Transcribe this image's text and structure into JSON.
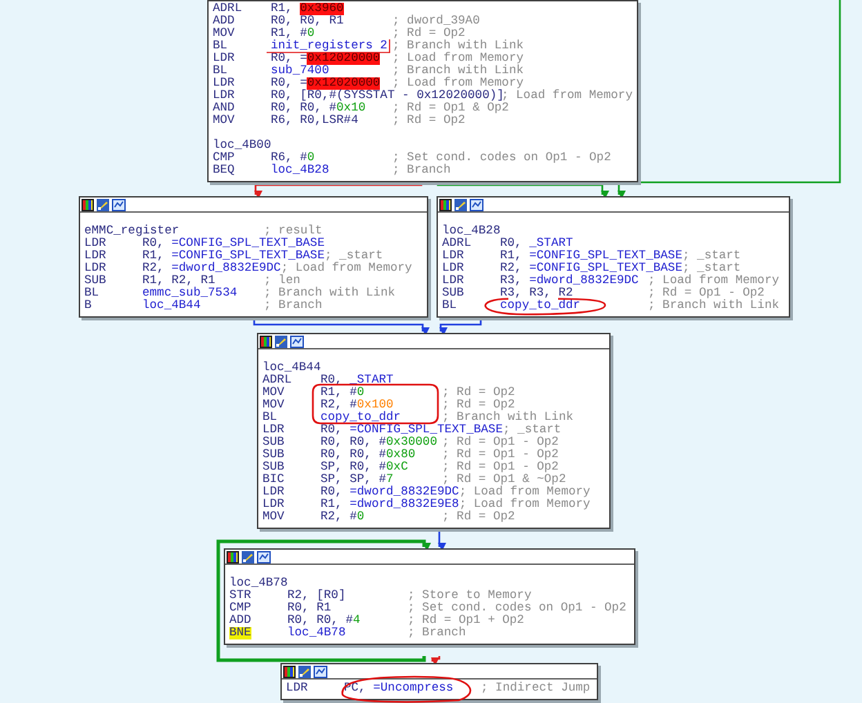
{
  "blocks": [
    {
      "toolbar": false,
      "lines": [
        {
          "kind": "ins",
          "mnemonic": "ADRL",
          "highlighted": false,
          "operands": [
            {
              "text": "R1, ",
              "kind": "reg"
            },
            {
              "text": "0x3960",
              "kind": "mark"
            }
          ]
        },
        {
          "kind": "ins",
          "mnemonic": "ADD",
          "highlighted": false,
          "operands": [
            {
              "text": "R0, R0, R1",
              "kind": "reg"
            }
          ],
          "comment": "; dword_39A0"
        },
        {
          "kind": "ins",
          "mnemonic": "MOV",
          "highlighted": false,
          "operands": [
            {
              "text": "R1, #",
              "kind": "reg"
            },
            {
              "text": "0",
              "kind": "num"
            }
          ],
          "comment": "; Rd = Op2"
        },
        {
          "kind": "ins",
          "mnemonic": "BL",
          "highlighted": false,
          "operands": [
            {
              "text": "init_registers 2",
              "kind": "name"
            }
          ],
          "comment": "; Branch with Link"
        },
        {
          "kind": "ins",
          "mnemonic": "LDR",
          "highlighted": false,
          "operands": [
            {
              "text": "R0, =",
              "kind": "reg"
            },
            {
              "text": "0x12020000",
              "kind": "mark"
            }
          ],
          "comment": "; Load from Memory"
        },
        {
          "kind": "ins",
          "mnemonic": "BL",
          "highlighted": false,
          "operands": [
            {
              "text": "sub_7400",
              "kind": "name"
            }
          ],
          "comment": "; Branch with Link"
        },
        {
          "kind": "ins",
          "mnemonic": "LDR",
          "highlighted": false,
          "operands": [
            {
              "text": "R0, =",
              "kind": "reg"
            },
            {
              "text": "0x12020000",
              "kind": "mark"
            }
          ],
          "comment": "; Load from Memory"
        },
        {
          "kind": "ins",
          "mnemonic": "LDR",
          "highlighted": false,
          "operands": [
            {
              "text": "R0, [R0,#(SYSSTAT - 0x12020000)]",
              "kind": "reg"
            }
          ],
          "comment": "; Load from Memory"
        },
        {
          "kind": "ins",
          "mnemonic": "AND",
          "highlighted": false,
          "operands": [
            {
              "text": "R0, R0, #",
              "kind": "reg"
            },
            {
              "text": "0x10",
              "kind": "num"
            }
          ],
          "comment": "; Rd = Op1 & Op2"
        },
        {
          "kind": "ins",
          "mnemonic": "MOV",
          "highlighted": false,
          "operands": [
            {
              "text": "R6, R0,LSR#4",
              "kind": "reg"
            }
          ],
          "comment": "; Rd = Op2"
        },
        {
          "kind": "blank"
        },
        {
          "kind": "label",
          "text": "loc_4B00"
        },
        {
          "kind": "ins",
          "mnemonic": "CMP",
          "highlighted": false,
          "operands": [
            {
              "text": "R6, #",
              "kind": "reg"
            },
            {
              "text": "0",
              "kind": "num"
            }
          ],
          "comment": "; Set cond. codes on Op1 - Op2"
        },
        {
          "kind": "ins",
          "mnemonic": "BEQ",
          "highlighted": false,
          "operands": [
            {
              "text": "loc_4B28",
              "kind": "name"
            }
          ],
          "comment": "; Branch"
        }
      ]
    },
    {
      "toolbar": true,
      "lines": [
        {
          "kind": "label",
          "text": "eMMC_register",
          "comment": "; result"
        },
        {
          "kind": "ins",
          "mnemonic": "LDR",
          "highlighted": false,
          "operands": [
            {
              "text": "R0, ",
              "kind": "reg"
            },
            {
              "text": "=CONFIG_SPL_TEXT_BASE",
              "kind": "name"
            }
          ]
        },
        {
          "kind": "ins",
          "mnemonic": "LDR",
          "highlighted": false,
          "operands": [
            {
              "text": "R1, ",
              "kind": "reg"
            },
            {
              "text": "=CONFIG_SPL_TEXT_BASE",
              "kind": "name"
            }
          ],
          "comment": "; _start"
        },
        {
          "kind": "ins",
          "mnemonic": "LDR",
          "highlighted": false,
          "operands": [
            {
              "text": "R2, ",
              "kind": "reg"
            },
            {
              "text": "=dword_8832E9DC",
              "kind": "name"
            }
          ],
          "comment": "; Load from Memory"
        },
        {
          "kind": "ins",
          "mnemonic": "SUB",
          "highlighted": false,
          "operands": [
            {
              "text": "R1, R2, R1",
              "kind": "reg"
            }
          ],
          "comment": "; len"
        },
        {
          "kind": "ins",
          "mnemonic": "BL",
          "highlighted": false,
          "operands": [
            {
              "text": "emmc_sub_7534",
              "kind": "name"
            }
          ],
          "comment": "; Branch with Link"
        },
        {
          "kind": "ins",
          "mnemonic": "B",
          "highlighted": false,
          "operands": [
            {
              "text": "loc_4B44",
              "kind": "name"
            }
          ],
          "comment": "; Branch"
        }
      ]
    },
    {
      "toolbar": true,
      "lines": [
        {
          "kind": "label",
          "text": "loc_4B28"
        },
        {
          "kind": "ins",
          "mnemonic": "ADRL",
          "highlighted": false,
          "operands": [
            {
              "text": "R0, ",
              "kind": "reg"
            },
            {
              "text": "_START",
              "kind": "name"
            }
          ]
        },
        {
          "kind": "ins",
          "mnemonic": "LDR",
          "highlighted": false,
          "operands": [
            {
              "text": "R1, ",
              "kind": "reg"
            },
            {
              "text": "=CONFIG_SPL_TEXT_BASE",
              "kind": "name"
            }
          ],
          "comment": "; _start"
        },
        {
          "kind": "ins",
          "mnemonic": "LDR",
          "highlighted": false,
          "operands": [
            {
              "text": "R2, ",
              "kind": "reg"
            },
            {
              "text": "=CONFIG_SPL_TEXT_BASE",
              "kind": "name"
            }
          ],
          "comment": "; _start"
        },
        {
          "kind": "ins",
          "mnemonic": "LDR",
          "highlighted": false,
          "operands": [
            {
              "text": "R3, ",
              "kind": "reg"
            },
            {
              "text": "=dword_8832E9DC",
              "kind": "name"
            }
          ],
          "comment": "; Load from Memory"
        },
        {
          "kind": "ins",
          "mnemonic": "SUB",
          "highlighted": false,
          "operands": [
            {
              "text": "R3, R3, R2",
              "kind": "reg"
            }
          ],
          "comment": "; Rd = Op1 - Op2"
        },
        {
          "kind": "ins",
          "mnemonic": "BL",
          "highlighted": false,
          "operands": [
            {
              "text": "copy_to_ddr",
              "kind": "name"
            }
          ],
          "comment": "; Branch with Link"
        }
      ]
    },
    {
      "toolbar": true,
      "lines": [
        {
          "kind": "label",
          "text": "loc_4B44"
        },
        {
          "kind": "ins",
          "mnemonic": "ADRL",
          "highlighted": false,
          "operands": [
            {
              "text": "R0, ",
              "kind": "reg"
            },
            {
              "text": "_START",
              "kind": "name"
            }
          ]
        },
        {
          "kind": "ins",
          "mnemonic": "MOV",
          "highlighted": false,
          "operands": [
            {
              "text": "R1, #",
              "kind": "reg"
            },
            {
              "text": "0",
              "kind": "num"
            }
          ],
          "comment": "; Rd = Op2"
        },
        {
          "kind": "ins",
          "mnemonic": "MOV",
          "highlighted": false,
          "operands": [
            {
              "text": "R2, #",
              "kind": "reg"
            },
            {
              "text": "0x100",
              "kind": "hex"
            }
          ],
          "comment": "; Rd = Op2"
        },
        {
          "kind": "ins",
          "mnemonic": "BL",
          "highlighted": false,
          "operands": [
            {
              "text": "copy_to_ddr",
              "kind": "name"
            }
          ],
          "comment": "; Branch with Link"
        },
        {
          "kind": "ins",
          "mnemonic": "LDR",
          "highlighted": false,
          "operands": [
            {
              "text": "R0, ",
              "kind": "reg"
            },
            {
              "text": "=CONFIG_SPL_TEXT_BASE",
              "kind": "name"
            }
          ],
          "comment": "; _start"
        },
        {
          "kind": "ins",
          "mnemonic": "SUB",
          "highlighted": false,
          "operands": [
            {
              "text": "R0, R0, #",
              "kind": "reg"
            },
            {
              "text": "0x30000",
              "kind": "num"
            }
          ],
          "comment": "; Rd = Op1 - Op2"
        },
        {
          "kind": "ins",
          "mnemonic": "SUB",
          "highlighted": false,
          "operands": [
            {
              "text": "R0, R0, #",
              "kind": "reg"
            },
            {
              "text": "0x80",
              "kind": "num"
            }
          ],
          "comment": "; Rd = Op1 - Op2"
        },
        {
          "kind": "ins",
          "mnemonic": "SUB",
          "highlighted": false,
          "operands": [
            {
              "text": "SP, R0, #",
              "kind": "reg"
            },
            {
              "text": "0xC",
              "kind": "num"
            }
          ],
          "comment": "; Rd = Op1 - Op2"
        },
        {
          "kind": "ins",
          "mnemonic": "BIC",
          "highlighted": false,
          "operands": [
            {
              "text": "SP, SP, #",
              "kind": "reg"
            },
            {
              "text": "7",
              "kind": "num"
            }
          ],
          "comment": "; Rd = Op1 & ~Op2"
        },
        {
          "kind": "ins",
          "mnemonic": "LDR",
          "highlighted": false,
          "operands": [
            {
              "text": "R0, ",
              "kind": "reg"
            },
            {
              "text": "=dword_8832E9DC",
              "kind": "name"
            }
          ],
          "comment": "; Load from Memory"
        },
        {
          "kind": "ins",
          "mnemonic": "LDR",
          "highlighted": false,
          "operands": [
            {
              "text": "R1, ",
              "kind": "reg"
            },
            {
              "text": "=dword_8832E9E8",
              "kind": "name"
            }
          ],
          "comment": "; Load from Memory"
        },
        {
          "kind": "ins",
          "mnemonic": "MOV",
          "highlighted": false,
          "operands": [
            {
              "text": "R2, #",
              "kind": "reg"
            },
            {
              "text": "0",
              "kind": "num"
            }
          ],
          "comment": "; Rd = Op2"
        }
      ]
    },
    {
      "toolbar": true,
      "lines": [
        {
          "kind": "label",
          "text": "loc_4B78"
        },
        {
          "kind": "ins",
          "mnemonic": "STR",
          "highlighted": false,
          "operands": [
            {
              "text": "R2, [R0]",
              "kind": "reg"
            }
          ],
          "comment": "; Store to Memory"
        },
        {
          "kind": "ins",
          "mnemonic": "CMP",
          "highlighted": false,
          "operands": [
            {
              "text": "R0, R1",
              "kind": "reg"
            }
          ],
          "comment": "; Set cond. codes on Op1 - Op2"
        },
        {
          "kind": "ins",
          "mnemonic": "ADD",
          "highlighted": false,
          "operands": [
            {
              "text": "R0, R0, #",
              "kind": "reg"
            },
            {
              "text": "4",
              "kind": "num"
            }
          ],
          "comment": "; Rd = Op1 + Op2"
        },
        {
          "kind": "ins",
          "mnemonic": "BNE",
          "highlighted": true,
          "operands": [
            {
              "text": "loc_4B78",
              "kind": "name"
            }
          ],
          "comment": "; Branch"
        }
      ]
    },
    {
      "toolbar": true,
      "lines": [
        {
          "kind": "ins",
          "mnemonic": "LDR",
          "highlighted": false,
          "operands": [
            {
              "text": "PC, ",
              "kind": "reg"
            },
            {
              "text": "=Uncompress",
              "kind": "name"
            }
          ],
          "comment": "; Indirect Jump"
        }
      ]
    }
  ]
}
